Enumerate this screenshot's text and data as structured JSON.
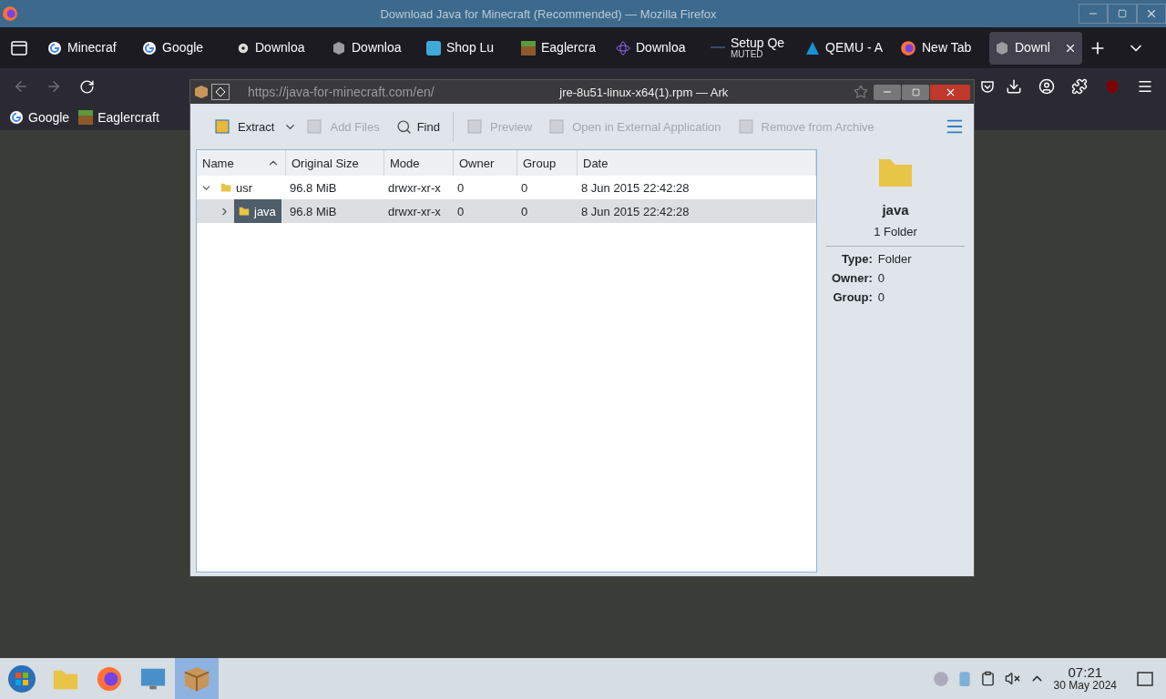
{
  "window": {
    "title": "Download Java for Minecraft (Recommended) — Mozilla Firefox"
  },
  "tabs": [
    {
      "label": "Minecraf",
      "kind": "google",
      "selected": false
    },
    {
      "label": "Google",
      "kind": "google",
      "selected": false
    },
    {
      "label": "Downloa",
      "kind": "disc",
      "selected": false
    },
    {
      "label": "Downloa",
      "kind": "cube",
      "selected": false
    },
    {
      "label": "Shop Lu",
      "kind": "shop",
      "selected": false
    },
    {
      "label": "Eaglercra",
      "kind": "grass",
      "selected": false
    },
    {
      "label": "Downloa",
      "kind": "atom",
      "selected": false
    },
    {
      "label": "Setup Qe",
      "sublabel": "MUTED",
      "kind": "dash",
      "selected": false
    },
    {
      "label": "QEMU - A",
      "kind": "arch",
      "selected": false
    },
    {
      "label": "New Tab",
      "kind": "firefox",
      "selected": false
    },
    {
      "label": "Downl",
      "kind": "cube",
      "selected": true
    }
  ],
  "address_bar": {
    "url": "https://java-for-minecraft.com/en/"
  },
  "bookmarks": [
    {
      "label": "Google",
      "kind": "google"
    },
    {
      "label": "Eaglercraft",
      "kind": "grass"
    }
  ],
  "ark": {
    "title": "jre-8u51-linux-x64(1).rpm — Ark",
    "actions": [
      {
        "label": "Extract",
        "disabled": false,
        "has_menu": true
      },
      {
        "label": "Add Files",
        "disabled": true,
        "has_menu": false
      },
      {
        "label": "Find",
        "disabled": false,
        "has_menu": false
      },
      {
        "label": "Preview",
        "disabled": true,
        "has_menu": false
      },
      {
        "label": "Open in External Application",
        "disabled": true,
        "has_menu": false
      },
      {
        "label": "Remove from Archive",
        "disabled": true,
        "has_menu": false
      }
    ],
    "columns": [
      {
        "label": "Name",
        "sorted": true
      },
      {
        "label": "Original Size",
        "sorted": false
      },
      {
        "label": "Mode",
        "sorted": false
      },
      {
        "label": "Owner",
        "sorted": false
      },
      {
        "label": "Group",
        "sorted": false
      },
      {
        "label": "Date",
        "sorted": false
      }
    ],
    "rows": [
      {
        "cells": [
          "usr",
          "96.8 MiB",
          "drwxr-xr-x",
          "0",
          "0",
          "8 Jun 2015 22:42:28"
        ],
        "expanded": true,
        "selected": false,
        "children": [
          {
            "cells": [
              "java",
              "96.8 MiB",
              "drwxr-xr-x",
              "0",
              "0",
              "8 Jun 2015 22:42:28"
            ],
            "expanded": false,
            "selected": true
          }
        ]
      }
    ],
    "details": {
      "name": "java",
      "summary": "1 Folder",
      "properties": [
        {
          "label": "Type:",
          "value": "Folder"
        },
        {
          "label": "Owner:",
          "value": "0"
        },
        {
          "label": "Group:",
          "value": "0"
        }
      ]
    }
  },
  "taskbar": {
    "apps": [
      {
        "kind": "start",
        "selected": false
      },
      {
        "kind": "files",
        "selected": false
      },
      {
        "kind": "firefox",
        "selected": false
      },
      {
        "kind": "settings",
        "selected": false
      },
      {
        "kind": "ark",
        "selected": true
      }
    ],
    "time": "07:21",
    "date": "30 May 2024"
  }
}
